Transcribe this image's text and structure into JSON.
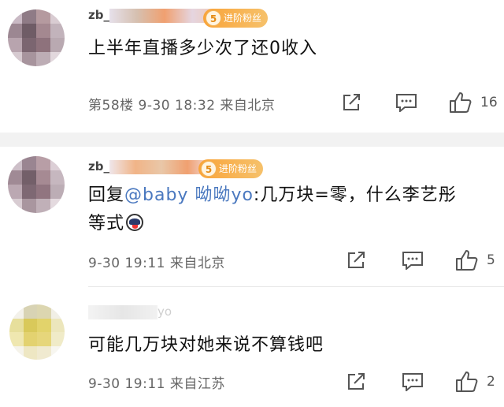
{
  "comments": [
    {
      "username": "zb_",
      "fan_badge": {
        "level": "5",
        "label": "进阶粉丝"
      },
      "text": "上半年直播多少次了还0收入",
      "meta": "第58楼 9-30 18:32 来自北京",
      "likes": "16"
    },
    {
      "username": "zb_",
      "fan_badge": {
        "level": "5",
        "label": "进阶粉丝"
      },
      "reply_prefix": "回复",
      "mention": "@baby 呦呦yo",
      "text_line1_rest": ":几万块=零，什么李艺彤",
      "text_line2": "等式",
      "meta": "9-30 19:11 来自北京",
      "likes": "5"
    },
    {
      "username": "yo",
      "text": "可能几万块对她来说不算钱吧",
      "meta": "9-30 19:11 来自江苏",
      "likes": "2"
    }
  ],
  "icons": {
    "share": "share-icon",
    "comment": "comment-icon",
    "like": "thumbs-up-icon"
  },
  "colors": {
    "mention": "#4a78bf",
    "badge": "#f9a43a",
    "section_gap": "#f2f2f2"
  }
}
